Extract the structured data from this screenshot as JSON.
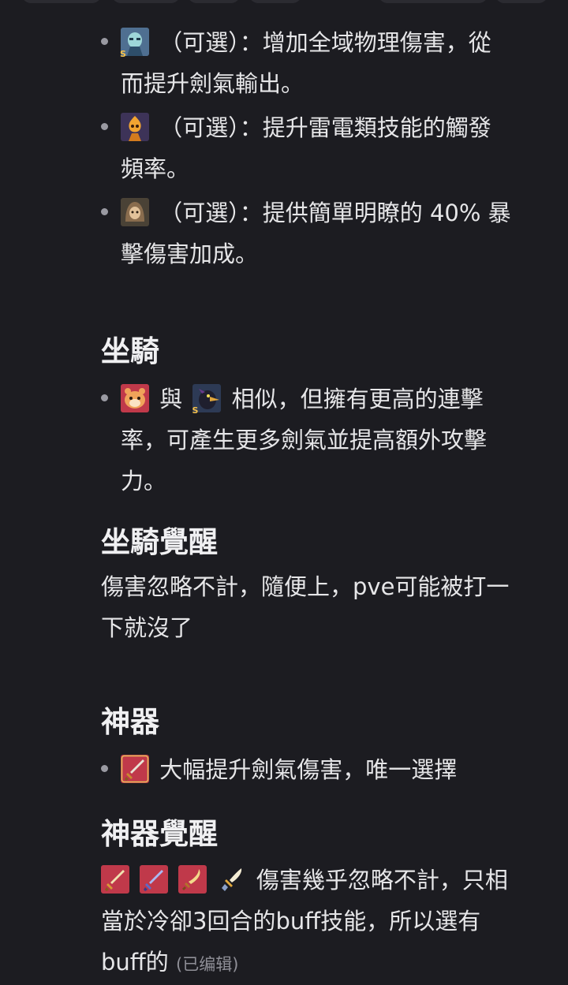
{
  "sections": {
    "intro_bullets": [
      {
        "icon": "ghost-character-icon",
        "text_line1": "（可選）：增加全域物理傷害，從",
        "text_line2": "而提升劍氣輸出。"
      },
      {
        "icon": "fire-spirit-character-icon",
        "text_line1": "（可選）：提升雷電類技能的觸發",
        "text_line2": "頻率。"
      },
      {
        "icon": "hooded-monk-character-icon",
        "text_line1": "（可選）：提供簡單明瞭的 40% 暴",
        "text_line2": "擊傷害加成。"
      }
    ],
    "mount": {
      "heading": "坐騎",
      "bullet": {
        "icon_a": "hamster-mount-icon",
        "connector": "與",
        "icon_b": "crow-mount-icon",
        "line1": "相似，但擁有更高的連擊",
        "line2": "率，可產生更多劍氣並提高額外攻擊",
        "line3": "力。"
      }
    },
    "mount_awakening": {
      "heading": "坐騎覺醒",
      "line1": "傷害忽略不計，隨便上，pve可能被打一",
      "line2": "下就沒了"
    },
    "artifact": {
      "heading": "神器",
      "bullet": {
        "icon": "sword-artifact-icon",
        "text": "大幅提升劍氣傷害，唯一選擇"
      }
    },
    "artifact_awakening": {
      "heading": "神器覺醒",
      "icons": [
        "gold-sword-icon",
        "blue-sword-icon",
        "curved-dagger-icon",
        "dagger-icon"
      ],
      "line1": "傷害幾乎忽略不計，只相",
      "line2": "當於冷卻3回合的buff技能，所以選有",
      "line3": "buff的",
      "edited_label": "(已编辑)"
    }
  },
  "colors": {
    "background": "#1c1c21",
    "text": "#e6e6e8",
    "heading": "#f0f0f2",
    "muted": "#8f8f97",
    "icon_red_bg": "#c0394a"
  }
}
